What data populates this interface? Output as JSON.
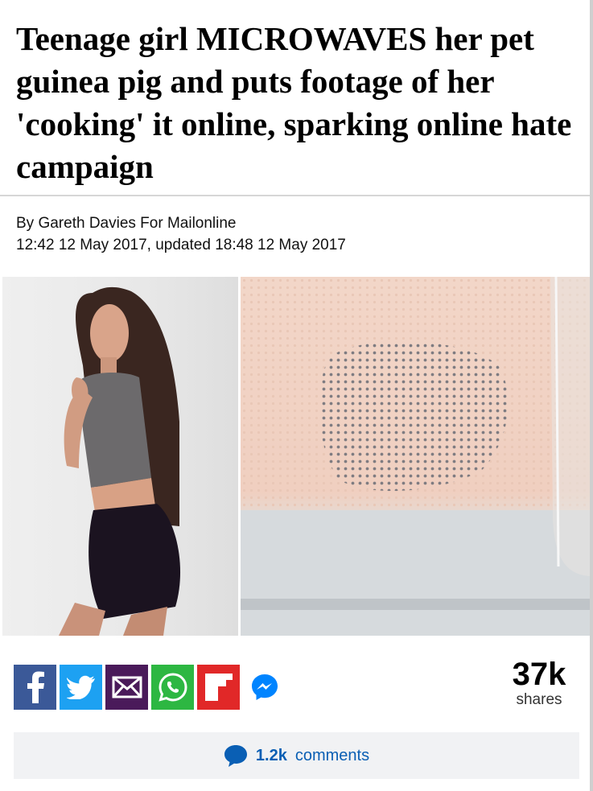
{
  "article": {
    "headline": "Teenage girl MICROWAVES her pet guinea pig and puts footage of her 'cooking' it online, sparking online hate campaign",
    "byline": "By Gareth Davies For Mailonline",
    "dateline": "12:42 12 May 2017, updated 18:48 12 May 2017"
  },
  "images": {
    "left": "photo-of-teenage-girl",
    "right": "microwave-interior-frame"
  },
  "share": {
    "buttons": [
      {
        "name": "facebook",
        "icon": "facebook-icon",
        "color": "#3b5998"
      },
      {
        "name": "twitter",
        "icon": "twitter-icon",
        "color": "#1da1f2"
      },
      {
        "name": "email",
        "icon": "email-icon",
        "color": "#4a1a5a"
      },
      {
        "name": "whatsapp",
        "icon": "whatsapp-icon",
        "color": "#2db742"
      },
      {
        "name": "flipboard",
        "icon": "flipboard-icon",
        "color": "#e12828"
      },
      {
        "name": "messenger",
        "icon": "messenger-icon",
        "color": "#0084ff"
      }
    ],
    "count": "37k",
    "count_label": "shares"
  },
  "comments": {
    "count": "1.2k",
    "label": "comments",
    "icon": "speech-bubble-icon",
    "color": "#0a5fb4"
  }
}
